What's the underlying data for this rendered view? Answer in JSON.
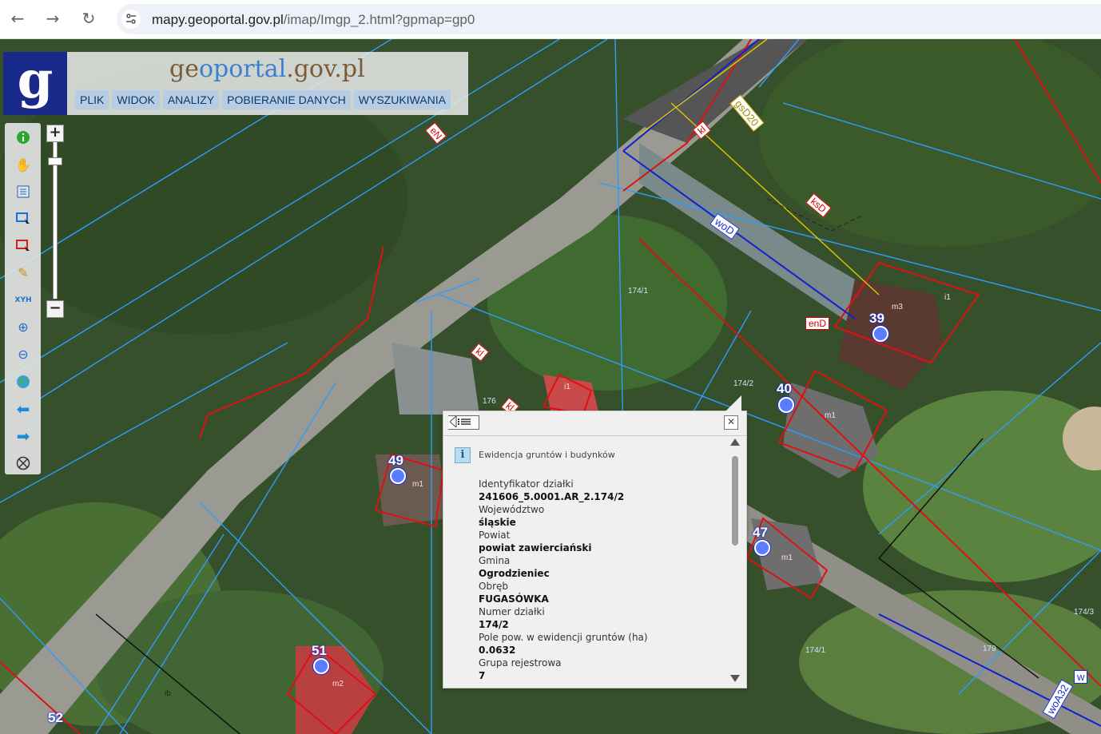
{
  "browser": {
    "url_host": "mapy.geoportal.gov.pl",
    "url_path": "/imap/Imgp_2.html?gpmap=gp0"
  },
  "header": {
    "logo_letter": "g",
    "site_title_a": "ge",
    "site_title_b": "oportal",
    "site_title_c": ".gov.pl",
    "menu": [
      "PLIK",
      "WIDOK",
      "ANALIZY",
      "POBIERANIE DANYCH",
      "WYSZUKIWANIA"
    ]
  },
  "toolbar": {
    "icons": [
      "info-icon",
      "hand-pan-icon",
      "layers-list-icon",
      "select-rectangle-icon",
      "select-red-icon",
      "pencil-icon",
      "xyh-icon",
      "zoom-in-icon",
      "zoom-out-icon",
      "globe-icon",
      "back-arrow-icon",
      "forward-arrow-icon",
      "crosshair-icon"
    ],
    "xyh_label": "XYH"
  },
  "zoom": {
    "plus": "+",
    "minus": "−",
    "level": 0.1
  },
  "map_labels": {
    "enN": "eN",
    "kl_top": "kl",
    "gsD20": "gsD20",
    "ksD": "ksD",
    "woD": "woD",
    "enD": "enD",
    "kl_mid": "kl",
    "kl_mid2": "kl",
    "woA32": "woA32",
    "w": "w",
    "parcel_1741_a": "174/1",
    "parcel_1742": "174/2",
    "parcel_176": "176",
    "parcel_1741_b": "174/1",
    "parcel_1743": "174/3",
    "parcel_179": "179",
    "parcel_ib": "ib",
    "buildings": [
      {
        "no": "39",
        "code": "m3"
      },
      {
        "no": "40",
        "code": "m1"
      },
      {
        "no": "49",
        "code": "m1"
      },
      {
        "no": "47",
        "code": "m1"
      },
      {
        "no": "51",
        "code": "m2"
      },
      {
        "no": "52",
        "code": ""
      }
    ],
    "i1_a": "i1",
    "i1_b": "i1"
  },
  "popup": {
    "section_title": "Ewidencja gruntów i budynków",
    "attributes": [
      {
        "label": "Identyfikator działki",
        "value": "241606_5.0001.AR_2.174/2"
      },
      {
        "label": "Województwo",
        "value": "śląskie"
      },
      {
        "label": "Powiat",
        "value": "powiat zawierciański"
      },
      {
        "label": "Gmina",
        "value": "Ogrodzieniec"
      },
      {
        "label": "Obręb",
        "value": "FUGASÓWKA"
      },
      {
        "label": "Numer działki",
        "value": "174/2"
      },
      {
        "label": "Pole pow. w ewidencji gruntów (ha)",
        "value": "0.0632"
      },
      {
        "label": "Grupa rejestrowa",
        "value": "7"
      }
    ]
  }
}
